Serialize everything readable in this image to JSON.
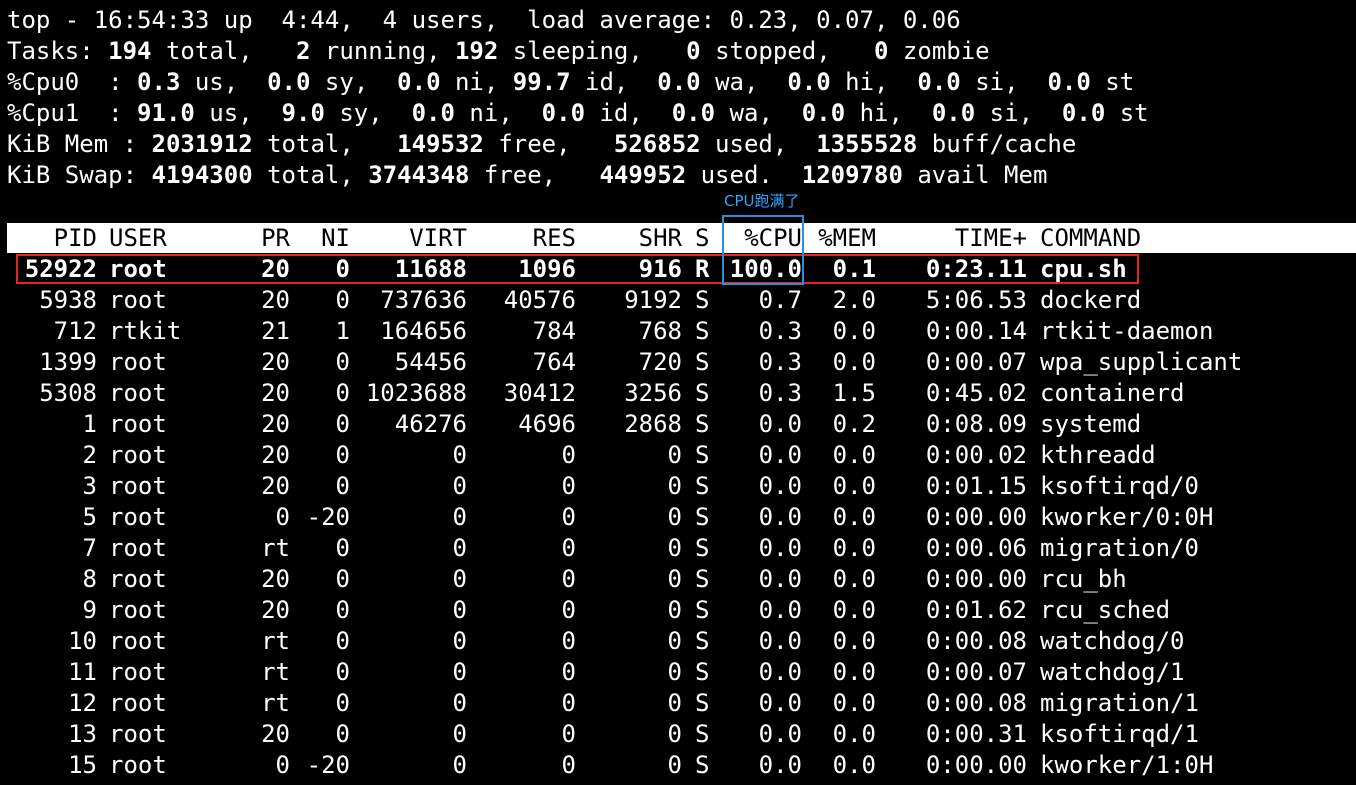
{
  "summary": {
    "line1": "top - 16:54:33 up  4:44,  4 users,  load average: 0.23, 0.07, 0.06",
    "tasks": {
      "label": "Tasks: ",
      "total": "194",
      "t_total": " total,   ",
      "running": "2",
      "t_running": " running, ",
      "sleeping": "192",
      "t_sleeping": " sleeping,   ",
      "stopped": "0",
      "t_stopped": " stopped,   ",
      "zombie": "0",
      "t_zombie": " zombie"
    },
    "cpu0": {
      "label": "%Cpu0  : ",
      "us": "0.3",
      "t_us": " us,  ",
      "sy": "0.0",
      "t_sy": " sy,  ",
      "ni": "0.0",
      "t_ni": " ni, ",
      "id": "99.7",
      "t_id": " id,  ",
      "wa": "0.0",
      "t_wa": " wa,  ",
      "hi": "0.0",
      "t_hi": " hi,  ",
      "si": "0.0",
      "t_si": " si,  ",
      "st": "0.0",
      "t_st": " st"
    },
    "cpu1": {
      "label": "%Cpu1  : ",
      "us": "91.0",
      "t_us": " us,  ",
      "sy": "9.0",
      "t_sy": " sy,  ",
      "ni": "0.0",
      "t_ni": " ni,  ",
      "id": "0.0",
      "t_id": " id,  ",
      "wa": "0.0",
      "t_wa": " wa,  ",
      "hi": "0.0",
      "t_hi": " hi,  ",
      "si": "0.0",
      "t_si": " si,  ",
      "st": "0.0",
      "t_st": " st"
    },
    "mem": {
      "label": "KiB Mem : ",
      "total": "2031912",
      "t_total": " total,   ",
      "free": "149532",
      "t_free": " free,   ",
      "used": "526852",
      "t_used": " used,  ",
      "cache": "1355528",
      "t_cache": " buff/cache"
    },
    "swap": {
      "label": "KiB Swap: ",
      "total": "4194300",
      "t_total": " total, ",
      "free": "3744348",
      "t_free": " free,   ",
      "used": "449952",
      "t_used": " used.  ",
      "avail": "1209780",
      "t_avail": " avail Mem"
    }
  },
  "annotation": "CPU跑满了",
  "header": {
    "pid": "PID",
    "user": "USER",
    "pr": "PR",
    "ni": "NI",
    "virt": "VIRT",
    "res": "RES",
    "shr": "SHR",
    "s": "S",
    "cpu": "%CPU",
    "mem": "%MEM",
    "time": "TIME+",
    "cmd": "COMMAND"
  },
  "processes": [
    {
      "pid": "52922",
      "user": "root",
      "pr": "20",
      "ni": "0",
      "virt": "11688",
      "res": "1096",
      "shr": "916",
      "s": "R",
      "cpu": "100.0",
      "mem": "0.1",
      "time": "0:23.11",
      "cmd": "cpu.sh"
    },
    {
      "pid": "5938",
      "user": "root",
      "pr": "20",
      "ni": "0",
      "virt": "737636",
      "res": "40576",
      "shr": "9192",
      "s": "S",
      "cpu": "0.7",
      "mem": "2.0",
      "time": "5:06.53",
      "cmd": "dockerd"
    },
    {
      "pid": "712",
      "user": "rtkit",
      "pr": "21",
      "ni": "1",
      "virt": "164656",
      "res": "784",
      "shr": "768",
      "s": "S",
      "cpu": "0.3",
      "mem": "0.0",
      "time": "0:00.14",
      "cmd": "rtkit-daemon"
    },
    {
      "pid": "1399",
      "user": "root",
      "pr": "20",
      "ni": "0",
      "virt": "54456",
      "res": "764",
      "shr": "720",
      "s": "S",
      "cpu": "0.3",
      "mem": "0.0",
      "time": "0:00.07",
      "cmd": "wpa_supplicant"
    },
    {
      "pid": "5308",
      "user": "root",
      "pr": "20",
      "ni": "0",
      "virt": "1023688",
      "res": "30412",
      "shr": "3256",
      "s": "S",
      "cpu": "0.3",
      "mem": "1.5",
      "time": "0:45.02",
      "cmd": "containerd"
    },
    {
      "pid": "1",
      "user": "root",
      "pr": "20",
      "ni": "0",
      "virt": "46276",
      "res": "4696",
      "shr": "2868",
      "s": "S",
      "cpu": "0.0",
      "mem": "0.2",
      "time": "0:08.09",
      "cmd": "systemd"
    },
    {
      "pid": "2",
      "user": "root",
      "pr": "20",
      "ni": "0",
      "virt": "0",
      "res": "0",
      "shr": "0",
      "s": "S",
      "cpu": "0.0",
      "mem": "0.0",
      "time": "0:00.02",
      "cmd": "kthreadd"
    },
    {
      "pid": "3",
      "user": "root",
      "pr": "20",
      "ni": "0",
      "virt": "0",
      "res": "0",
      "shr": "0",
      "s": "S",
      "cpu": "0.0",
      "mem": "0.0",
      "time": "0:01.15",
      "cmd": "ksoftirqd/0"
    },
    {
      "pid": "5",
      "user": "root",
      "pr": "0",
      "ni": "-20",
      "virt": "0",
      "res": "0",
      "shr": "0",
      "s": "S",
      "cpu": "0.0",
      "mem": "0.0",
      "time": "0:00.00",
      "cmd": "kworker/0:0H"
    },
    {
      "pid": "7",
      "user": "root",
      "pr": "rt",
      "ni": "0",
      "virt": "0",
      "res": "0",
      "shr": "0",
      "s": "S",
      "cpu": "0.0",
      "mem": "0.0",
      "time": "0:00.06",
      "cmd": "migration/0"
    },
    {
      "pid": "8",
      "user": "root",
      "pr": "20",
      "ni": "0",
      "virt": "0",
      "res": "0",
      "shr": "0",
      "s": "S",
      "cpu": "0.0",
      "mem": "0.0",
      "time": "0:00.00",
      "cmd": "rcu_bh"
    },
    {
      "pid": "9",
      "user": "root",
      "pr": "20",
      "ni": "0",
      "virt": "0",
      "res": "0",
      "shr": "0",
      "s": "S",
      "cpu": "0.0",
      "mem": "0.0",
      "time": "0:01.62",
      "cmd": "rcu_sched"
    },
    {
      "pid": "10",
      "user": "root",
      "pr": "rt",
      "ni": "0",
      "virt": "0",
      "res": "0",
      "shr": "0",
      "s": "S",
      "cpu": "0.0",
      "mem": "0.0",
      "time": "0:00.08",
      "cmd": "watchdog/0"
    },
    {
      "pid": "11",
      "user": "root",
      "pr": "rt",
      "ni": "0",
      "virt": "0",
      "res": "0",
      "shr": "0",
      "s": "S",
      "cpu": "0.0",
      "mem": "0.0",
      "time": "0:00.07",
      "cmd": "watchdog/1"
    },
    {
      "pid": "12",
      "user": "root",
      "pr": "rt",
      "ni": "0",
      "virt": "0",
      "res": "0",
      "shr": "0",
      "s": "S",
      "cpu": "0.0",
      "mem": "0.0",
      "time": "0:00.08",
      "cmd": "migration/1"
    },
    {
      "pid": "13",
      "user": "root",
      "pr": "20",
      "ni": "0",
      "virt": "0",
      "res": "0",
      "shr": "0",
      "s": "S",
      "cpu": "0.0",
      "mem": "0.0",
      "time": "0:00.31",
      "cmd": "ksoftirqd/1"
    },
    {
      "pid": "15",
      "user": "root",
      "pr": "0",
      "ni": "-20",
      "virt": "0",
      "res": "0",
      "shr": "0",
      "s": "S",
      "cpu": "0.0",
      "mem": "0.0",
      "time": "0:00.00",
      "cmd": "kworker/1:0H"
    }
  ],
  "colors": {
    "background": "#000000",
    "text": "#ffffff",
    "header_bg": "#ffffff",
    "row_highlight": "#e3261f",
    "column_highlight": "#2b8fd6",
    "annotation": "#2ea6ff"
  }
}
